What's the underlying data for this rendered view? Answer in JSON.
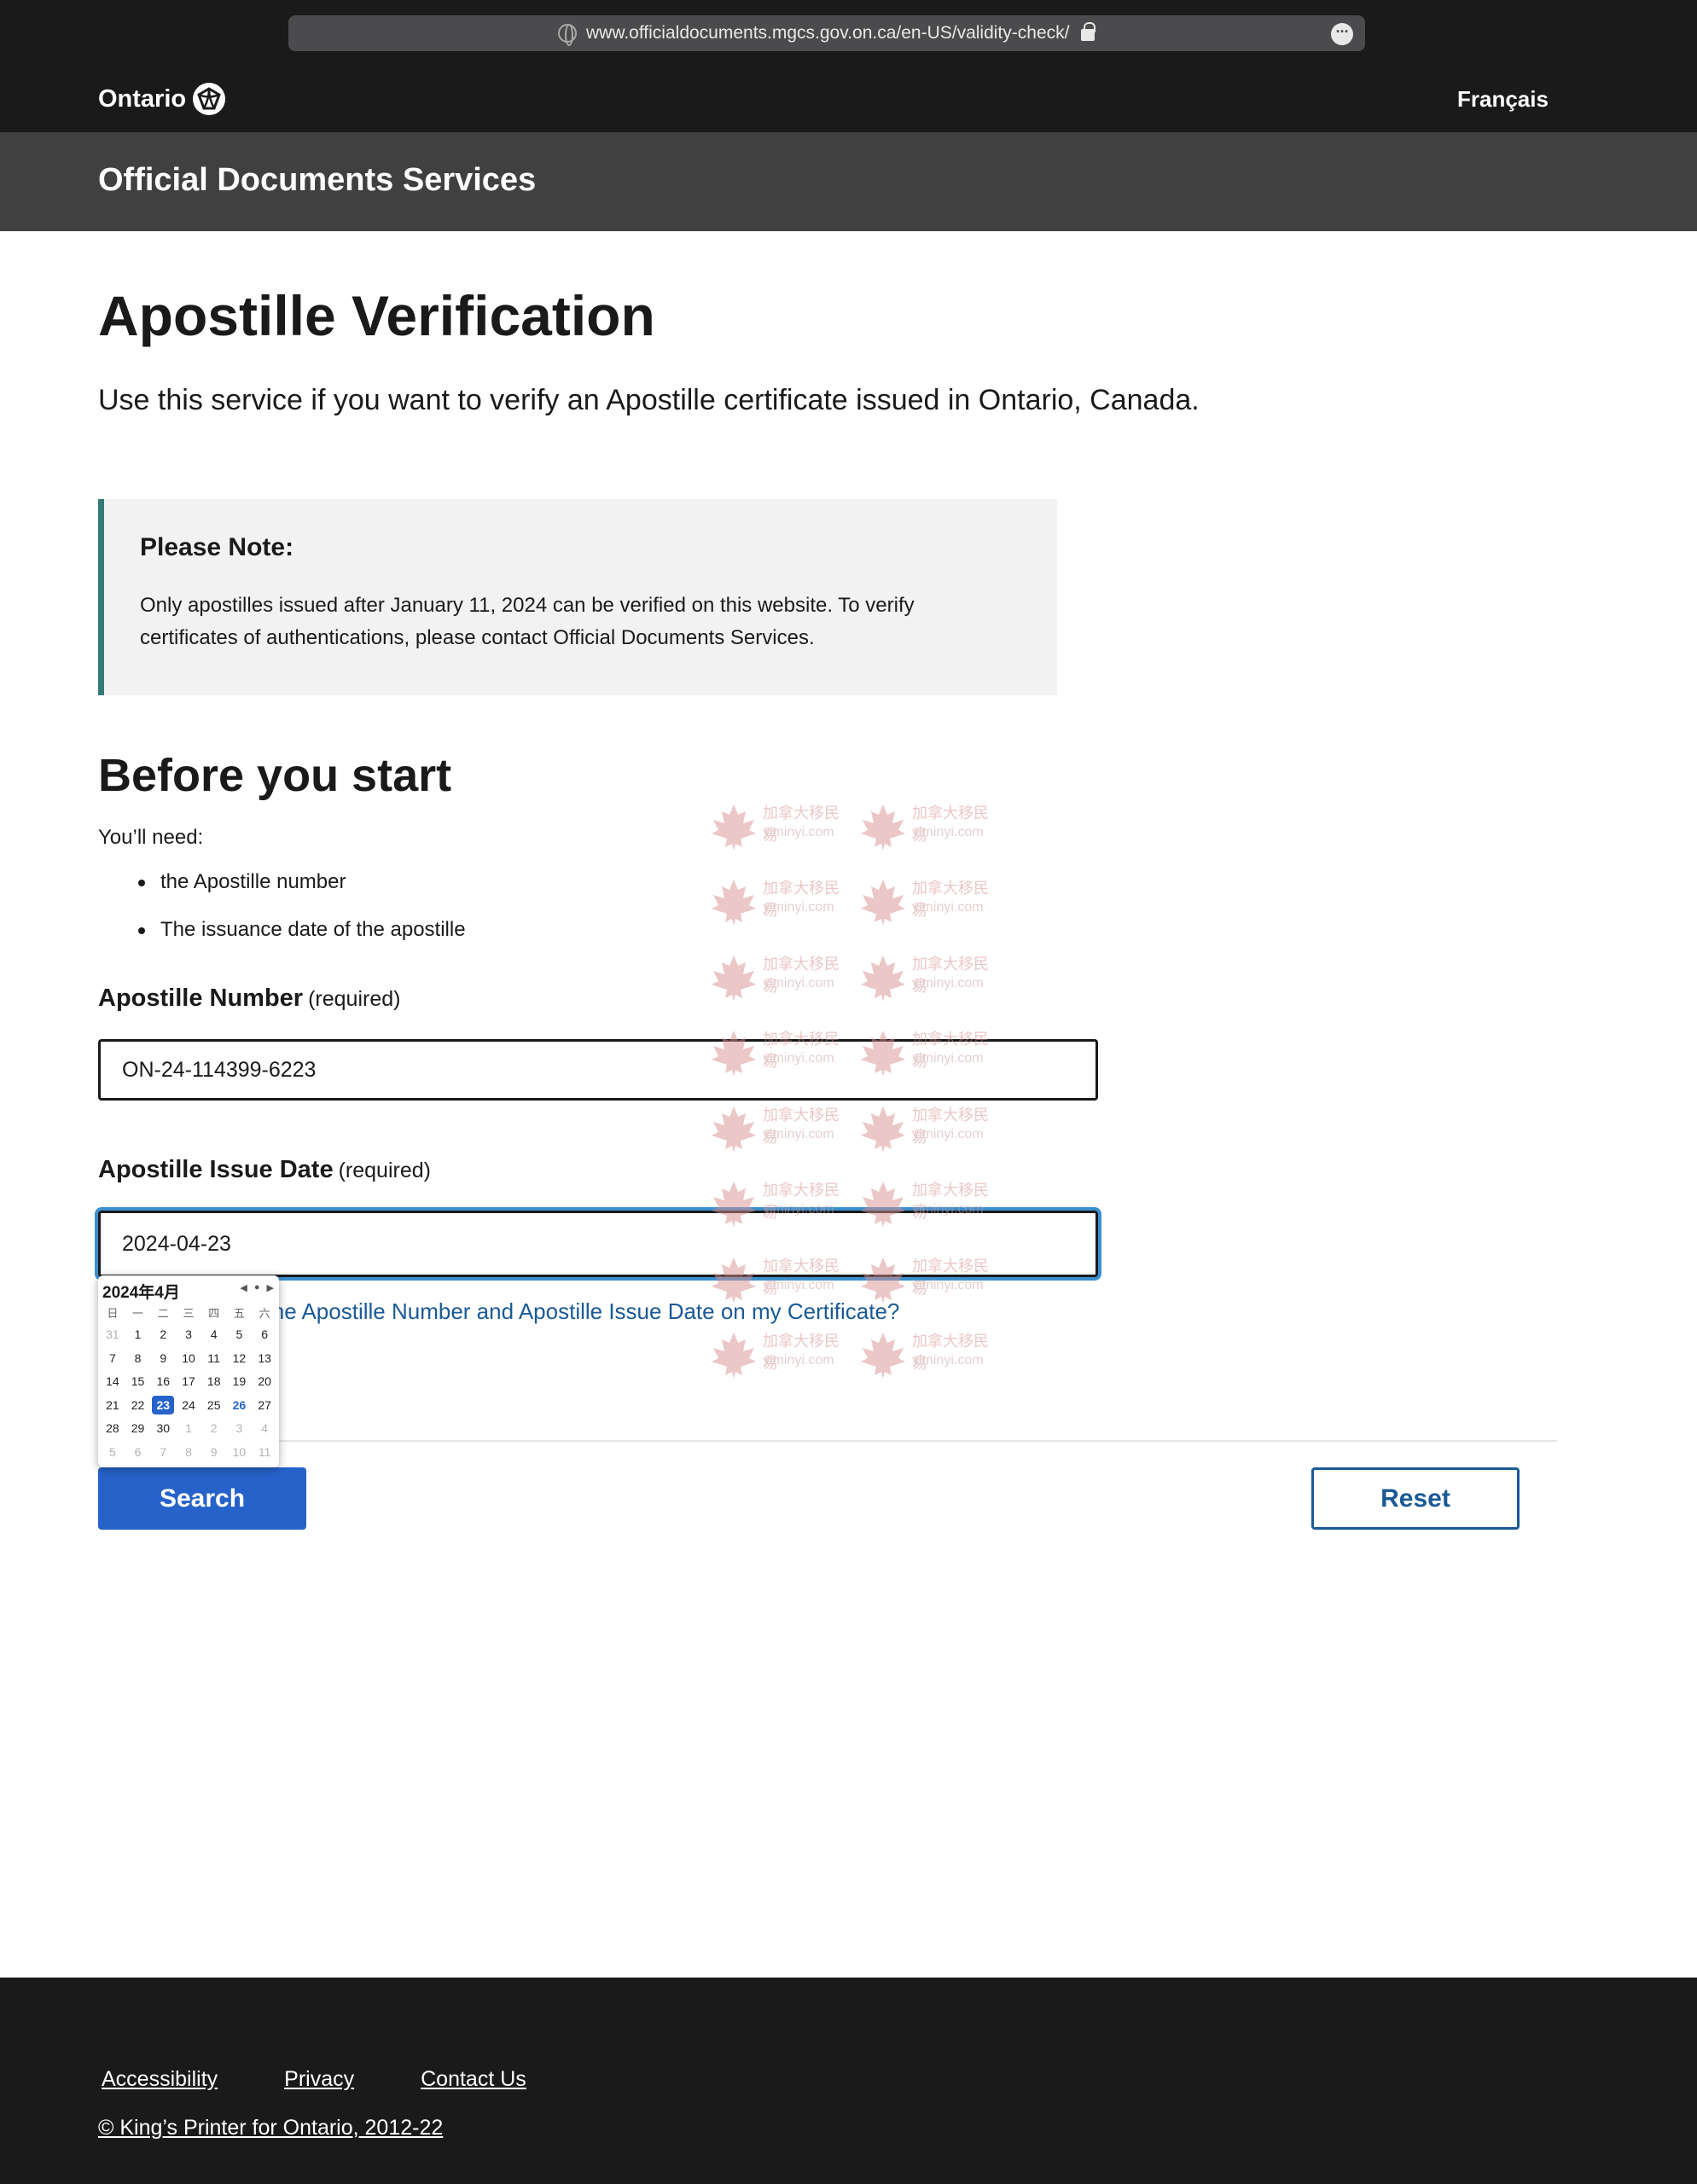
{
  "browser": {
    "url": "www.officialdocuments.mgcs.gov.on.ca/en-US/validity-check/"
  },
  "header": {
    "logo_text": "Ontario",
    "language_toggle": "Français",
    "service_title": "Official Documents Services"
  },
  "main": {
    "title": "Apostille Verification",
    "intro": "Use this service if you want to verify an Apostille certificate issued in Ontario, Canada.",
    "note": {
      "heading": "Please Note:",
      "body": "Only apostilles issued after January 11, 2024 can be verified on this website. To verify certificates of authentications, please contact Official Documents Services."
    },
    "before_start": {
      "title": "Before you start",
      "need_label": "You’ll need:",
      "items": [
        "the Apostille number",
        "The issuance date of the apostille"
      ]
    },
    "apostille_number": {
      "label": "Apostille Number",
      "required": "(required)",
      "value": "ON-24-114399-6223"
    },
    "apostille_date": {
      "label": "Apostille Issue Date",
      "required": "(required)",
      "value": "2024-04-23"
    },
    "help_link": "Where can I find the Apostille Number and Apostille Issue Date on my Certificate?",
    "search_button": "Search",
    "reset_button": "Reset"
  },
  "datepicker": {
    "month_label": "2024年4月",
    "weekdays": [
      "日",
      "一",
      "二",
      "三",
      "四",
      "五",
      "六"
    ],
    "weeks": [
      [
        "31",
        "1",
        "2",
        "3",
        "4",
        "5",
        "6"
      ],
      [
        "7",
        "8",
        "9",
        "10",
        "11",
        "12",
        "13"
      ],
      [
        "14",
        "15",
        "16",
        "17",
        "18",
        "19",
        "20"
      ],
      [
        "21",
        "22",
        "23",
        "24",
        "25",
        "26",
        "27"
      ],
      [
        "28",
        "29",
        "30",
        "1",
        "2",
        "3",
        "4"
      ],
      [
        "5",
        "6",
        "7",
        "8",
        "9",
        "10",
        "11"
      ]
    ],
    "selected_day": "23",
    "today_day": "26"
  },
  "watermark": {
    "cn_text": "加拿大移民易",
    "en_text": "yiminyi.com",
    "color": "#d89090"
  },
  "footer": {
    "links": [
      "Accessibility",
      "Privacy",
      "Contact Us"
    ],
    "copyright": "© King’s Printer for Ontario, 2012-22"
  },
  "colors": {
    "header_bg": "#1a1a1a",
    "service_bar_bg": "#404040",
    "note_border": "#367a76",
    "primary_button": "#2662c9",
    "link": "#1a5a96",
    "focus_ring": "#3b8fcf"
  }
}
